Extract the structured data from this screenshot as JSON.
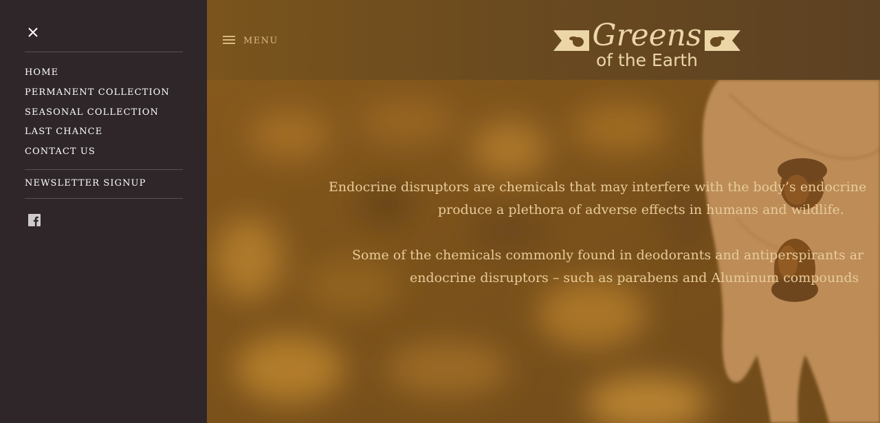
{
  "drawer": {
    "nav_items": [
      {
        "label": "HOME"
      },
      {
        "label": "PERMANENT COLLECTION"
      },
      {
        "label": "SEASONAL COLLECTION"
      },
      {
        "label": "LAST CHANCE"
      },
      {
        "label": "CONTACT US"
      }
    ],
    "newsletter_label": "NEWSLETTER SIGNUP",
    "social": [
      "facebook-icon"
    ],
    "close_icon": "close-icon"
  },
  "header": {
    "menu_label": "MENU",
    "menu_icon": "hamburger-icon",
    "logo": {
      "line1": "Greens",
      "line2": "of the Earth",
      "color": "#ecd6a8"
    }
  },
  "hero": {
    "paragraph1_line1": "Endocrine disruptors are chemicals that may interfere with the body’s endocrine",
    "paragraph1_line2": "produce a plethora of adverse effects in humans and wildlife.",
    "paragraph2_line1": "Some of the chemicals commonly found in deodorants and antiperspirants ar",
    "paragraph2_line2": "endocrine disruptors – such as parabens and Aluminum compounds"
  },
  "colors": {
    "drawer_bg": "#2e2628",
    "header_bg": "#6a4a1f",
    "accent_text": "#d9bb86"
  }
}
